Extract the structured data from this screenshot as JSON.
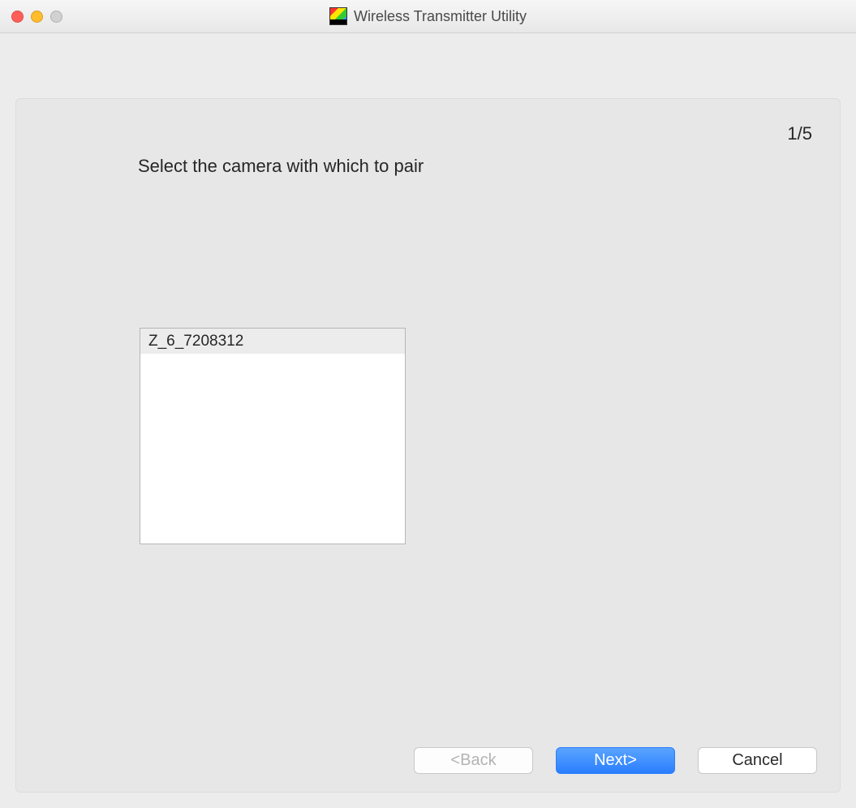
{
  "window": {
    "title": "Wireless Transmitter Utility"
  },
  "wizard": {
    "step_indicator": "1/5",
    "instruction": "Select the camera with which to pair",
    "camera_list": {
      "items": [
        "Z_6_7208312"
      ],
      "selected_index": 0
    },
    "buttons": {
      "back": "<Back",
      "next": "Next>",
      "cancel": "Cancel"
    }
  }
}
